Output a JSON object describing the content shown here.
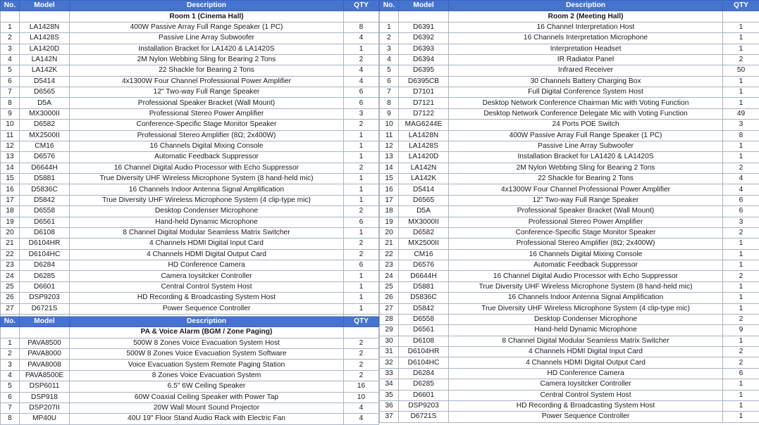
{
  "headers": {
    "no": "No.",
    "model": "Model",
    "description": "Description",
    "qty": "QTY"
  },
  "room1": {
    "title": "Room 1 (Cinema Hall)",
    "rows": [
      [
        "1",
        "LA1428N",
        "400W Passive Array Full Range Speaker (1 PC)",
        "8"
      ],
      [
        "2",
        "LA1428S",
        "Passive Line Array Subwoofer",
        "4"
      ],
      [
        "3",
        "LA1420D",
        "Installation Bracket for LA1420 & LA1420S",
        "1"
      ],
      [
        "4",
        "LA142N",
        "2M Nylon Webbing Sling for Bearing 2 Tons",
        "2"
      ],
      [
        "5",
        "LA142K",
        "22 Shackle for Bearing 2 Tons",
        "4"
      ],
      [
        "6",
        "D5414",
        "4x1300W Four Channel Professional Power Amplifier",
        "4"
      ],
      [
        "7",
        "D6565",
        "12\" Two-way Full Range Speaker",
        "6"
      ],
      [
        "8",
        "D5A",
        "Professional Speaker Bracket (Wall Mount)",
        "6"
      ],
      [
        "9",
        "MX3000II",
        "Professional Stereo Power Amplifier",
        "3"
      ],
      [
        "10",
        "D6582",
        "Conference-Specific Stage Monitor Speaker",
        "2"
      ],
      [
        "11",
        "MX2500II",
        "Professional Stereo Amplifier (8Ω; 2x400W)",
        "1"
      ],
      [
        "12",
        "CM16",
        "16 Channels Digital Mixing Console",
        "1"
      ],
      [
        "13",
        "D6576",
        "Automatic Feedback Suppressor",
        "1"
      ],
      [
        "14",
        "D6644H",
        "16 Channel Digital Audio Processor with Echo Suppressor",
        "2"
      ],
      [
        "15",
        "D5881",
        "True Diversity UHF Wireless Microphone System (8 hand-held mic)",
        "1"
      ],
      [
        "16",
        "D5836C",
        "16 Channels Indoor Antenna Signal Amplification",
        "1"
      ],
      [
        "17",
        "D5842",
        "True Diversity UHF Wireless Microphone System (4 clip-type mic)",
        "1"
      ],
      [
        "18",
        "D6558",
        "Desktop Condenser Microphone",
        "2"
      ],
      [
        "19",
        "D6561",
        "Hand-held Dynamic Microphone",
        "6"
      ],
      [
        "20",
        "D6108",
        "8 Channel Digital Modular Seamless Matrix Switcher",
        "1"
      ],
      [
        "21",
        "D6104HR",
        "4 Channels HDMI Digital Input Card",
        "2"
      ],
      [
        "22",
        "D6104HC",
        "4 Channels HDMI Digital Output Card",
        "2"
      ],
      [
        "23",
        "D6284",
        "HD Conference Camera",
        "6"
      ],
      [
        "24",
        "D6285",
        "Camera Ioysitcker Controller",
        "1"
      ],
      [
        "25",
        "D6601",
        "Central Control System Host",
        "1"
      ],
      [
        "26",
        "DSP9203",
        "HD Recording & Broadcasting System Host",
        "1"
      ],
      [
        "27",
        "D6721S",
        "Power Sequence Controller",
        "1"
      ]
    ]
  },
  "pa": {
    "title": "PA & Voice Alarm (BGM / Zone Paging)",
    "rows": [
      [
        "1",
        "PAVA8500",
        "500W 8 Zones Voice Evacuation System Host",
        "2"
      ],
      [
        "2",
        "PAVA8000",
        "500W 8 Zones Voice Evacuation System  Software",
        "2"
      ],
      [
        "3",
        "PAVA8008",
        "Voice Evacuation System Remote Paging Station",
        "2"
      ],
      [
        "4",
        "PAVA8500E",
        "8 Zones Voice Evacuation System",
        "2"
      ],
      [
        "5",
        "DSP6011",
        "6.5\" 6W  Ceiling Speaker",
        "16"
      ],
      [
        "6",
        "DSP918",
        "60W Coaxial Ceiling Speaker with Power Tap",
        "10"
      ],
      [
        "7",
        "DSP207II",
        "20W Wall Mount Sound Projector",
        "4"
      ],
      [
        "8",
        "MP40U",
        "40U 19\" Floor Stand Audio Rack with Electric Fan",
        "4"
      ]
    ]
  },
  "room2": {
    "title": "Room 2 (Meeting Hall)",
    "rows": [
      [
        "1",
        "D6391",
        "16 Channel Interpretation Host",
        "1"
      ],
      [
        "2",
        "D6392",
        "16 Channels Interpretation Microphone",
        "1"
      ],
      [
        "3",
        "D6393",
        "Interpretation Headset",
        "1"
      ],
      [
        "4",
        "D6394",
        "IR Radiator Panel",
        "2"
      ],
      [
        "5",
        "D6395",
        "Infrared Receiver",
        "50"
      ],
      [
        "6",
        "D6395CB",
        "30 Channels Battery Charging Box",
        "1"
      ],
      [
        "7",
        "D7101",
        "Full Digital Conference System Host",
        "1"
      ],
      [
        "8",
        "D7121",
        "Desktop Network Conference Chairman Mic with Voting Function",
        "1"
      ],
      [
        "9",
        "D7122",
        "Desktop Network Conference Delegate Mic with Voting Function",
        "49"
      ],
      [
        "10",
        "MAG6244E",
        "24 Ports POE Switch",
        "3"
      ],
      [
        "11",
        "LA1428N",
        "400W Passive Array Full Range Speaker (1 PC)",
        "8"
      ],
      [
        "12",
        "LA1428S",
        "Passive Line Array Subwoofer",
        "1"
      ],
      [
        "13",
        "LA1420D",
        "Installation Bracket for LA1420 & LA1420S",
        "1"
      ],
      [
        "14",
        "LA142N",
        "2M Nylon Webbing Sling for Bearing 2 Tons",
        "2"
      ],
      [
        "15",
        "LA142K",
        "22 Shackle for Bearing 2 Tons",
        "4"
      ],
      [
        "16",
        "D5414",
        "4x1300W Four Channel Professional Power Amplifier",
        "4"
      ],
      [
        "17",
        "D6565",
        "12\" Two-way Full Range Speaker",
        "6"
      ],
      [
        "18",
        "D5A",
        "Professional Speaker Bracket (Wall Mount)",
        "6"
      ],
      [
        "19",
        "MX3000II",
        "Professional Stereo Power Amplifier",
        "3"
      ],
      [
        "20",
        "D6582",
        "Conference-Specific Stage Monitor Speaker",
        "2"
      ],
      [
        "21",
        "MX2500II",
        "Professional Stereo Amplifier (8Ω; 2x400W)",
        "1"
      ],
      [
        "22",
        "CM16",
        "16 Channels Digital Mixing Console",
        "1"
      ],
      [
        "23",
        "D6576",
        "Automatic Feedback Suppressor",
        "1"
      ],
      [
        "24",
        "D6644H",
        "16 Channel Digital Audio Processor with Echo Suppressor",
        "2"
      ],
      [
        "25",
        "D5881",
        "True Diversity UHF Wireless Microphone System (8 hand-held mic)",
        "1"
      ],
      [
        "26",
        "D5836C",
        "16 Channels Indoor Antenna Signal Amplification",
        "1"
      ],
      [
        "27",
        "D5842",
        "True Diversity UHF Wireless Microphone System (4 clip-type mic)",
        "1"
      ],
      [
        "28",
        "D6558",
        "Desktop Condenser Microphone",
        "2"
      ],
      [
        "29",
        "D6561",
        "Hand-held Dynamic Microphone",
        "9"
      ],
      [
        "30",
        "D6108",
        "8 Channel Digital Modular Seamless Matrix Switcher",
        "1"
      ],
      [
        "31",
        "D6104HR",
        "4 Channels HDMI Digital Input Card",
        "2"
      ],
      [
        "32",
        "D6104HC",
        "4 Channels HDMI Digital Output Card",
        "2"
      ],
      [
        "33",
        "D6284",
        "HD Conference Camera",
        "6"
      ],
      [
        "34",
        "D6285",
        "Camera Ioysitcker Controller",
        "1"
      ],
      [
        "35",
        "D6601",
        "Central Control System Host",
        "1"
      ],
      [
        "36",
        "DSP9203",
        "HD Recording & Broadcasting System Host",
        "1"
      ],
      [
        "37",
        "D6721S",
        "Power Sequence Controller",
        "1"
      ]
    ]
  }
}
